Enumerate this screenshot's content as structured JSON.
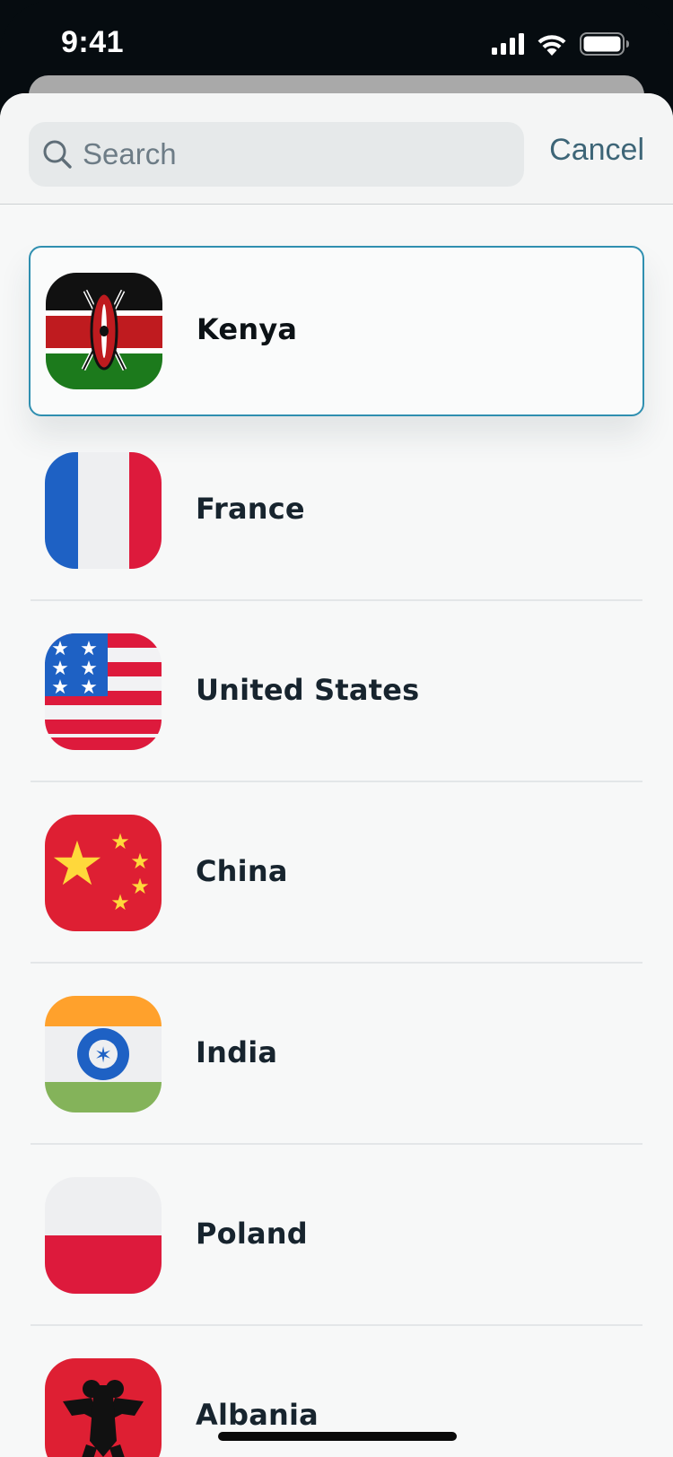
{
  "status_bar": {
    "time": "9:41"
  },
  "search": {
    "placeholder": "Search",
    "value": "",
    "cancel_label": "Cancel"
  },
  "countries": [
    {
      "name": "Kenya",
      "flag_icon": "kenya-flag-icon",
      "selected": true
    },
    {
      "name": "France",
      "flag_icon": "france-flag-icon",
      "selected": false
    },
    {
      "name": "United States",
      "flag_icon": "united-states-flag-icon",
      "selected": false
    },
    {
      "name": "China",
      "flag_icon": "china-flag-icon",
      "selected": false
    },
    {
      "name": "India",
      "flag_icon": "india-flag-icon",
      "selected": false
    },
    {
      "name": "Poland",
      "flag_icon": "poland-flag-icon",
      "selected": false
    },
    {
      "name": "Albania",
      "flag_icon": "albania-flag-icon",
      "selected": false
    }
  ],
  "colors": {
    "accent": "#2f8fb0",
    "cancel_text": "#3d6577",
    "background": "#f7f8f8"
  }
}
